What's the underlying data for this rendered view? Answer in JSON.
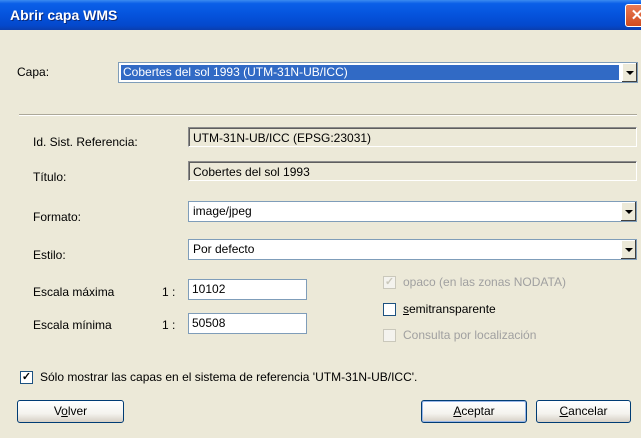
{
  "window": {
    "title": "Abrir capa WMS",
    "close_glyph": "✕"
  },
  "capa": {
    "label": "Capa:",
    "value": "Cobertes del sol 1993 (UTM-31N-UB/ICC)"
  },
  "fields": {
    "ref_label": "Id. Sist. Referencia:",
    "ref_value": "UTM-31N-UB/ICC (EPSG:23031)",
    "titulo_label": "Título:",
    "titulo_value": "Cobertes del sol 1993",
    "formato_label": "Formato:",
    "formato_value": "image/jpeg",
    "estilo_label": "Estilo:",
    "estilo_value": "Por defecto",
    "escala_max_label": "Escala máxima",
    "escala_max_prefix": "1 :",
    "escala_max_value": "10102",
    "escala_min_label": "Escala mínima",
    "escala_min_prefix": "1 :",
    "escala_min_value": "50508"
  },
  "options": {
    "opaco": {
      "label": "opaco (en las zonas NODATA)",
      "checked": true,
      "enabled": false
    },
    "semitransparente": {
      "label_first": "s",
      "label_rest": "emitransparente",
      "checked": false,
      "enabled": true
    },
    "consulta": {
      "label": "Consulta por localización",
      "checked": false,
      "enabled": false
    }
  },
  "filter": {
    "label": "Sólo mostrar las capas en el sistema de referencia 'UTM-31N-UB/ICC'.",
    "checked": true
  },
  "buttons": {
    "volver_first": "V",
    "volver_under": "o",
    "volver_rest": "lver",
    "aceptar_under": "A",
    "aceptar_rest": "ceptar",
    "cancelar_under": "C",
    "cancelar_rest": "ancelar"
  },
  "icons": {
    "check": "✓",
    "dropdown": "chevron-down-icon"
  }
}
